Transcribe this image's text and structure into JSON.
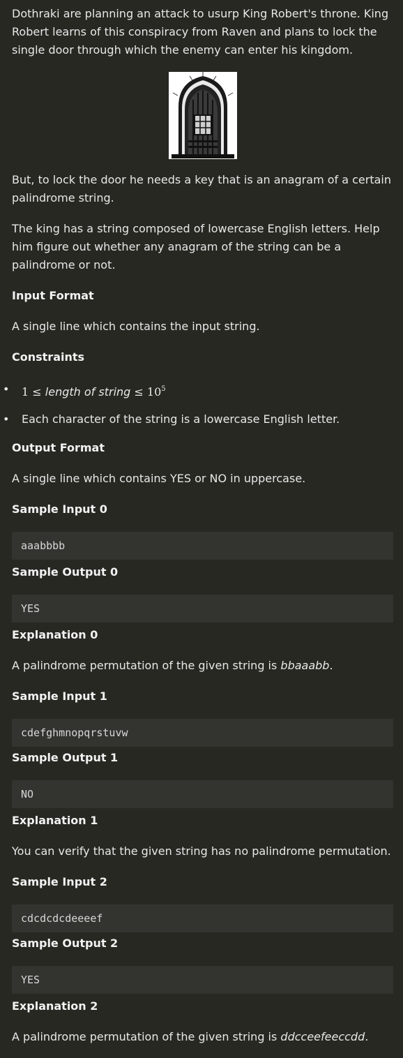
{
  "intro": {
    "paragraph1": "Dothraki are planning an attack to usurp King Robert's throne. King Robert learns of this conspiracy from Raven and plans to lock the single door through which the enemy can enter his kingdom.",
    "paragraph2": "But, to lock the door he needs a key that is an anagram of a certain palindrome string.",
    "paragraph3": "The king has a string composed of lowercase English letters. Help him figure out whether any anagram of the string can be a palindrome or not."
  },
  "input_format": {
    "heading": "Input Format",
    "text": "A single line which contains the input string."
  },
  "constraints": {
    "heading": "Constraints",
    "bullet1": {
      "lhs": "1",
      "op1": "≤",
      "middle": "length of string",
      "op2": "≤",
      "base": "10",
      "exp": "5"
    },
    "bullet2": "Each character of the string is a lowercase English letter."
  },
  "output_format": {
    "heading": "Output Format",
    "text": "A single line which contains YES or NO in uppercase."
  },
  "samples": [
    {
      "input_heading": "Sample Input 0",
      "input": "aaabbbb",
      "output_heading": "Sample Output 0",
      "output": "YES",
      "explanation_heading": "Explanation 0",
      "explanation_prefix": "A palindrome permutation of the given string is ",
      "explanation_em": "bbaaabb",
      "explanation_suffix": "."
    },
    {
      "input_heading": "Sample Input 1",
      "input": "cdefghmnopqrstuvw",
      "output_heading": "Sample Output 1",
      "output": "NO",
      "explanation_heading": "Explanation 1",
      "explanation_prefix": "You can verify that the given string has no palindrome permutation.",
      "explanation_em": "",
      "explanation_suffix": ""
    },
    {
      "input_heading": "Sample Input 2",
      "input": "cdcdcdcdeeeef",
      "output_heading": "Sample Output 2",
      "output": "YES",
      "explanation_heading": "Explanation 2",
      "explanation_prefix": "A palindrome permutation of the given string is ",
      "explanation_em": "ddcceefeeccdd",
      "explanation_suffix": "."
    }
  ],
  "illustration": {
    "icon": "gothic-door-illustration"
  },
  "colors": {
    "background": "#272822",
    "code_background": "#33332f",
    "text": "#e8e8e8"
  }
}
